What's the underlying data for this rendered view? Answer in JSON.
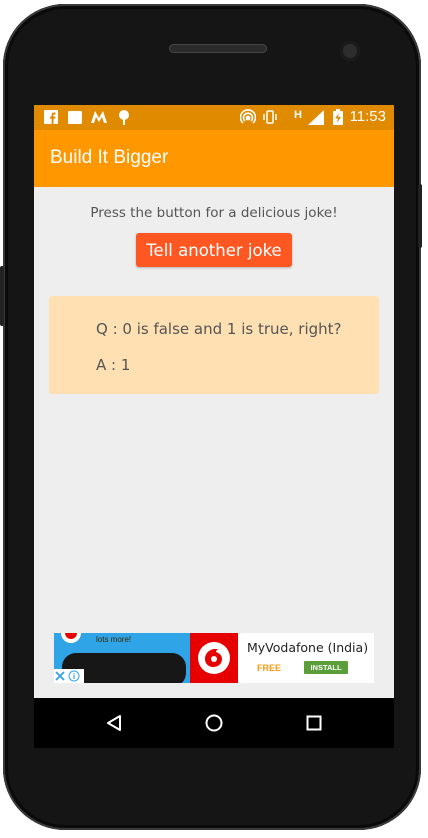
{
  "status_bar": {
    "time": "11:53",
    "network_type": "H",
    "notification_icons": [
      "facebook-icon",
      "message-icon",
      "myntra-icon",
      "android-icon"
    ],
    "system_icons": [
      "hotspot-icon",
      "vibrate-icon",
      "signal-icon",
      "battery-charging-icon"
    ]
  },
  "toolbar": {
    "title": "Build It Bigger",
    "color": "#ff9800"
  },
  "main": {
    "instructions": "Press the button for a delicious joke!",
    "button_label": "Tell another joke",
    "button_color": "#ff5722",
    "joke": {
      "question": "Q : 0 is false and 1 is true, right?",
      "answer": "A : 1",
      "card_color": "#ffe0b2"
    }
  },
  "ad": {
    "promo_text": "lots more!",
    "app_name": "MyVodafone (India)",
    "price_label": "FREE",
    "install_label": "INSTALL"
  },
  "nav_bar": {
    "buttons": [
      "back-icon",
      "home-icon",
      "recents-icon"
    ]
  }
}
